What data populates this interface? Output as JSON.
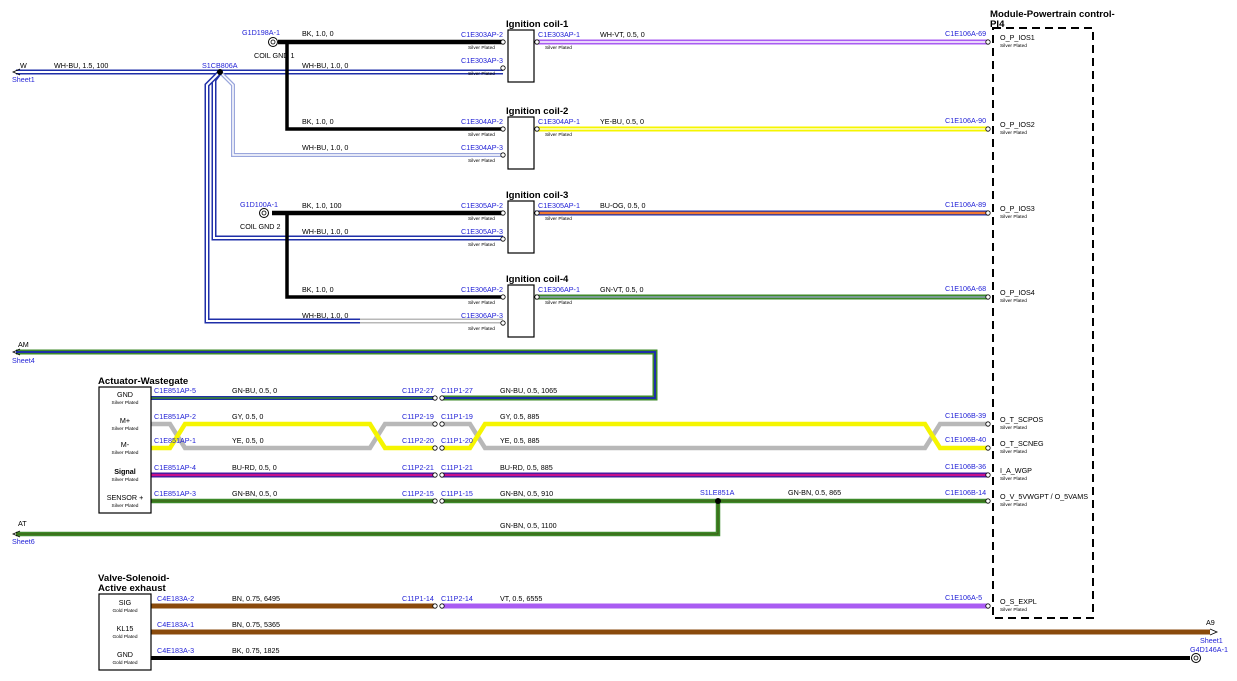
{
  "colors": {
    "BK": "#000000",
    "WH": "#ffffff",
    "BU": "#1f2fa8",
    "VT": "#a95cf2",
    "YE": "#f5f500",
    "OG": "#f07830",
    "GN": "#3d8a2a",
    "BN": "#8a4a0c",
    "GY": "#b8b8b8",
    "RD": "#d82020",
    "link": "#1f1fd6"
  },
  "module": {
    "title_line1": "Module-Powertrain control-",
    "title_line2": "PI4",
    "pins": [
      {
        "connector": "C1E106A-69",
        "signal": "O_P_IOS1",
        "plating": "Silver Plated"
      },
      {
        "connector": "C1E106A-90",
        "signal": "O_P_IOS2",
        "plating": "Silver Plated"
      },
      {
        "connector": "C1E106A-89",
        "signal": "O_P_IOS3",
        "plating": "Silver Plated"
      },
      {
        "connector": "C1E106A-68",
        "signal": "O_P_IOS4",
        "plating": "Silver Plated"
      },
      {
        "connector": "C1E106B-39",
        "signal": "O_T_SCPOS",
        "plating": "Silver Plated"
      },
      {
        "connector": "C1E106B-40",
        "signal": "O_T_SCNEG",
        "plating": "Silver Plated"
      },
      {
        "connector": "C1E106B-36",
        "signal": "I_A_WGP",
        "plating": "Silver Plated"
      },
      {
        "connector": "C1E106B-14",
        "signal": "O_V_5VWGPT / O_5VAMS",
        "plating": "Silver Plated"
      },
      {
        "connector": "C1E106A-5",
        "signal": "O_S_EXPL",
        "plating": "Silver Plated"
      }
    ]
  },
  "coils": [
    {
      "title": "Ignition coil-1",
      "pin_a": "C1E303AP-2",
      "pin_b": "C1E303AP-3",
      "pin_out": "C1E303AP-1",
      "plating": "Silver Plated",
      "wire_a": "BK,  1.0,  0",
      "wire_b": "WH-BU,  1.0,  0",
      "wire_out": "WH-VT,  0.5,  0"
    },
    {
      "title": "Ignition coil-2",
      "pin_a": "C1E304AP-2",
      "pin_b": "C1E304AP-3",
      "pin_out": "C1E304AP-1",
      "plating": "Silver Plated",
      "wire_a": "BK,  1.0,  0",
      "wire_b": "WH-BU,  1.0,  0",
      "wire_out": "YE-BU,  0.5,  0"
    },
    {
      "title": "Ignition coil-3",
      "pin_a": "C1E305AP-2",
      "pin_b": "C1E305AP-3",
      "pin_out": "C1E305AP-1",
      "plating": "Silver Plated",
      "wire_a": "BK,  1.0,  100",
      "wire_b": "WH-BU,  1.0,  0",
      "wire_out": "BU-OG,  0.5,  0"
    },
    {
      "title": "Ignition coil-4",
      "pin_a": "C1E306AP-2",
      "pin_b": "C1E306AP-3",
      "pin_out": "C1E306AP-1",
      "plating": "Silver Plated",
      "wire_a": "BK,  1.0,  0",
      "wire_b": "WH-BU,  1.0,  0",
      "wire_out": "GN-VT,  0.5,  0"
    }
  ],
  "grounds": [
    {
      "id": "G1D198A-1",
      "label": "COIL GND 1"
    },
    {
      "id": "G1D100A-1",
      "label": "COIL GND 2"
    }
  ],
  "splices": {
    "wh_bu": "S1CB806A",
    "gn_bn": "S1LE851A"
  },
  "sheet_refs": [
    {
      "code": "W",
      "sheet": "Sheet1",
      "wire": "WH-BU,  1.5,  100"
    },
    {
      "code": "AM",
      "sheet": "Sheet4"
    },
    {
      "code": "AT",
      "sheet": "Sheet6",
      "wire": "GN-BN,  0.5,  1100"
    },
    {
      "code": "A9",
      "sheet": "Sheet1"
    }
  ],
  "wastegate": {
    "title": "Actuator-Wastegate",
    "pins": [
      {
        "name": "GND",
        "plating": "Silver Plated",
        "connector": "C1E851AP-5",
        "wire_left": "GN-BU,  0.5,  0",
        "inline_a": "C11P2-27",
        "inline_b": "C11P1-27",
        "wire_right": "GN-BU,  0.5,  1065"
      },
      {
        "name": "M+",
        "plating": "Silver Plated",
        "connector": "C1E851AP-2",
        "wire_left": "GY,  0.5,  0",
        "inline_a": "C11P2-19",
        "inline_b": "C11P1-19",
        "wire_right": "GY,  0.5,  885"
      },
      {
        "name": "M-",
        "plating": "Silver Plated",
        "connector": "C1E851AP-1",
        "wire_left": "YE,  0.5,  0",
        "inline_a": "C11P2-20",
        "inline_b": "C11P1-20",
        "wire_right": "YE,  0.5,  885"
      },
      {
        "name": "Signal",
        "plating": "Silver Plated",
        "connector": "C1E851AP-4",
        "wire_left": "BU-RD,  0.5,  0",
        "inline_a": "C11P2-21",
        "inline_b": "C11P1-21",
        "wire_right": "BU-RD,  0.5,  885"
      },
      {
        "name": "SENSOR +",
        "plating": "Silver Plated",
        "connector": "C1E851AP-3",
        "wire_left": "GN-BN,  0.5,  0",
        "inline_a": "C11P2-15",
        "inline_b": "C11P1-15",
        "wire_right": "GN-BN,  0.5,  910",
        "wire_far": "GN-BN,  0.5,  865"
      }
    ]
  },
  "exhaust": {
    "title_line1": "Valve-Solenoid-",
    "title_line2": "Active exhaust",
    "pins": [
      {
        "name": "SIG",
        "plating": "Gold Plated",
        "connector": "C4E183A-2",
        "wire_left": "BN,  0.75,  6495",
        "inline_a": "C11P1-14",
        "inline_b": "C11P2-14",
        "wire_right": "VT,  0.5,  6555"
      },
      {
        "name": "KL15",
        "plating": "Gold Plated",
        "connector": "C4E183A-1",
        "wire_left": "BN,  0.75,  5365"
      },
      {
        "name": "GND",
        "plating": "Gold Plated",
        "connector": "C4E183A-3",
        "wire_left": "BK,  0.75,  1825",
        "ground": "G4D146A-1"
      }
    ]
  }
}
